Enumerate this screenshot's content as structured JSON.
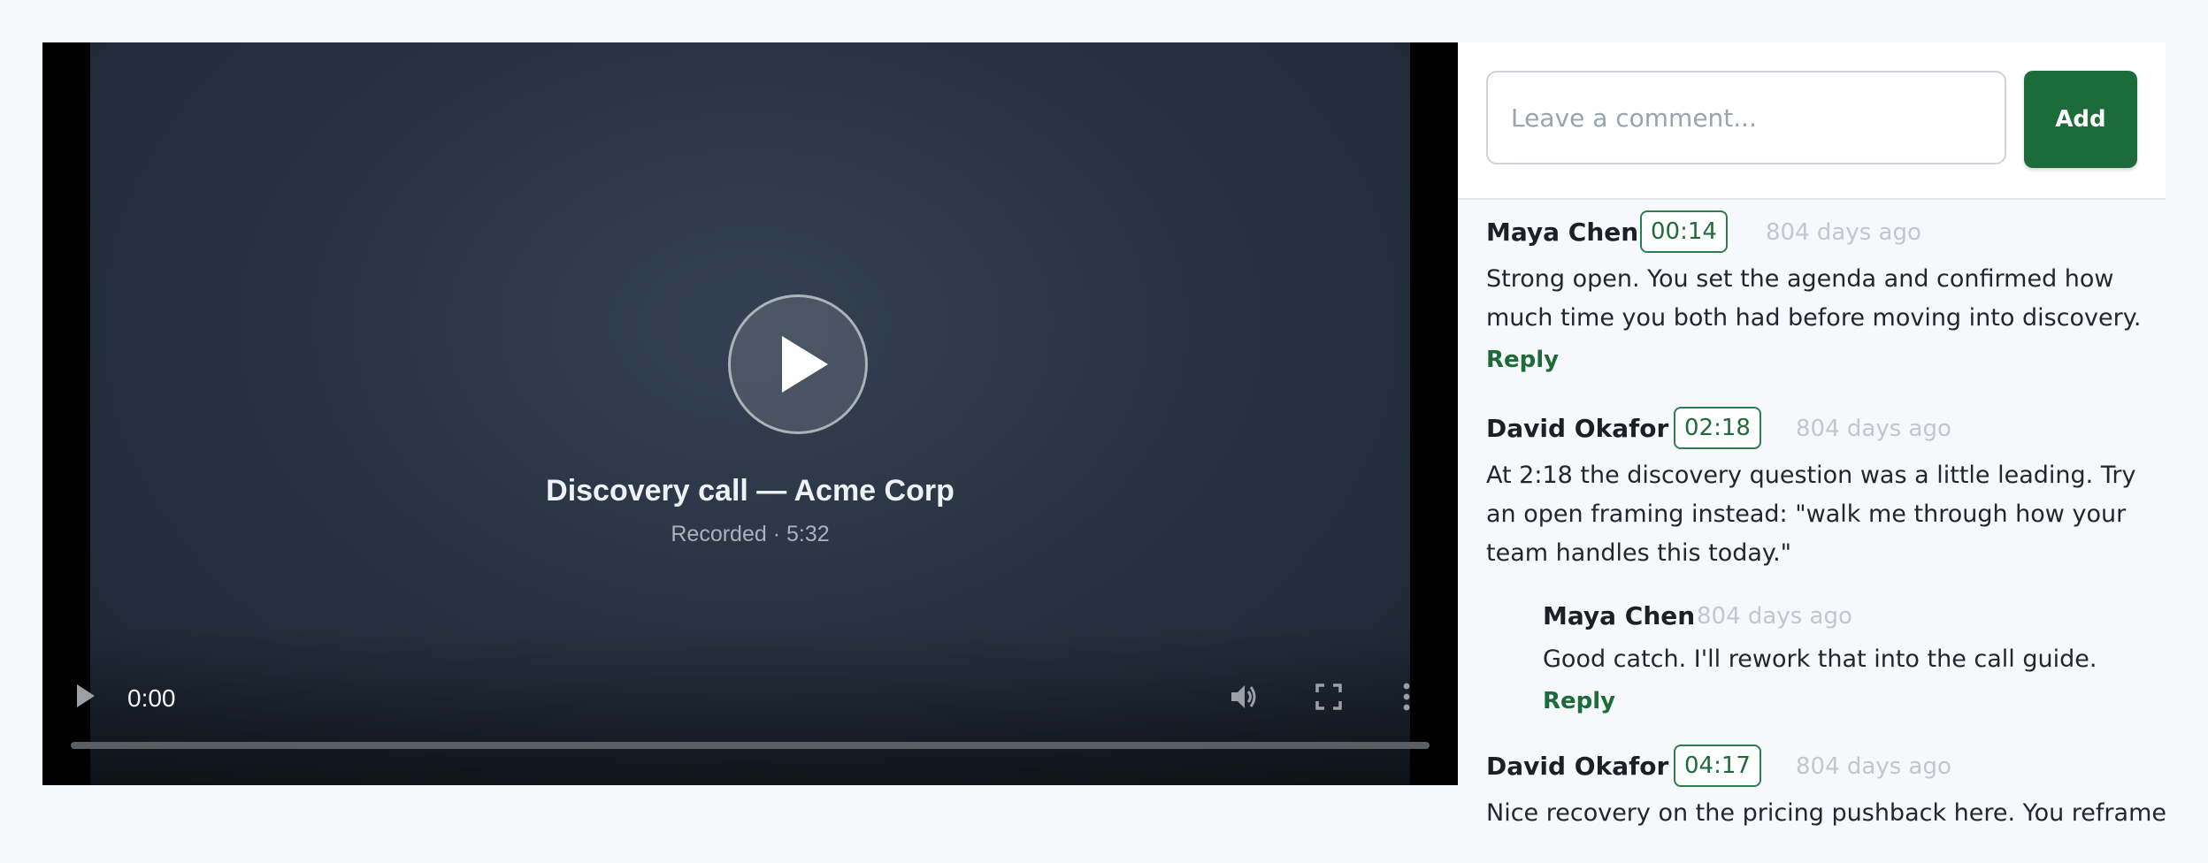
{
  "video": {
    "title": "Discovery call — Acme Corp",
    "subtitle": "Recorded · 5:32",
    "current_time": "0:00",
    "progress_fraction": 0
  },
  "composer": {
    "placeholder": "Leave a comment...",
    "add_label": "Add"
  },
  "comments": [
    {
      "author": "Maya Chen",
      "timestamp": "00:14",
      "age": "804 days ago",
      "text": "Strong open. You set the agenda and confirmed how much time you both had before moving into discovery.",
      "reply_label": "Reply"
    },
    {
      "author": "David Okafor",
      "timestamp": "02:18",
      "age": "804 days ago",
      "text": "At 2:18 the discovery question was a little leading. Try an open framing instead: \"walk me through how your team handles this today.\"",
      "replies": [
        {
          "author": "Maya Chen",
          "age": "804 days ago",
          "text": "Good catch. I'll rework that into the call guide.",
          "reply_label": "Reply"
        }
      ]
    },
    {
      "author": "David Okafor",
      "timestamp": "04:17",
      "age": "804 days ago",
      "text": "Nice recovery on the pricing pushback here. You reframed"
    }
  ],
  "colors": {
    "accent": "#1e6b3a",
    "muted": "#c2c7cd",
    "page_bg": "#f6f8fb"
  }
}
